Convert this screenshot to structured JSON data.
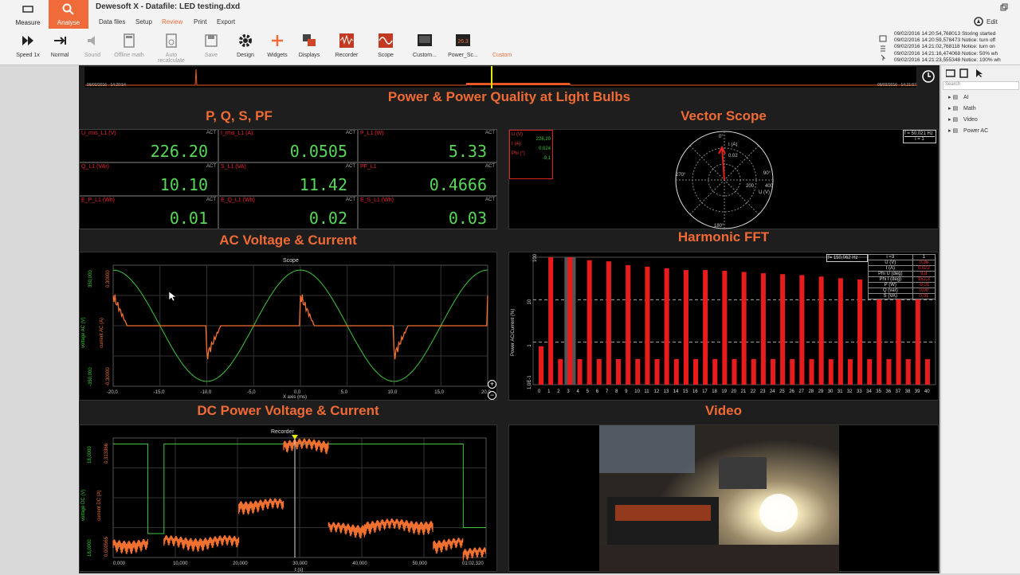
{
  "app": {
    "title": "Dewesoft X - Datafile: LED testing.dxd"
  },
  "tiles": {
    "measure": "Measure",
    "analyse": "Analyse"
  },
  "menu": {
    "datafiles": "Data files",
    "setup": "Setup",
    "review": "Review",
    "print": "Print",
    "export": "Export",
    "edit": "Edit"
  },
  "toolbar": {
    "speed": "Speed 1x",
    "normal": "Normal",
    "sound": "Sound",
    "offline": "Offline math",
    "recalc": "Auto recalculate",
    "save": "Save",
    "design": "Design",
    "widgets": "Widgets",
    "displays": "Displays",
    "recorder": "Recorder",
    "scope": "Scope",
    "custom": "Custom...",
    "power": "Power_Sc...",
    "custom2": "Custom",
    "power_badge": "26.3"
  },
  "log": [
    "09/02/2016 14:20:54,768013 Storing started",
    "09/02/2016 14:20:59,578473 Notice: turn off",
    "09/02/2016 14:21:02,768118 Notice: turn on",
    "09/02/2016 14:21:16,474068 Notice: 50% wh",
    "09/02/2016 14:21:23,555348 Notice: 100% wh"
  ],
  "overview": {
    "start": "09/02/2016 - 14:20:54",
    "end": "09/02/2016 - 14:21:57"
  },
  "headings": {
    "main": "Power & Power Quality at Light Bulbs",
    "pq": "P, Q, S, PF",
    "vector": "Vector Scope",
    "ac": "AC Voltage & Current",
    "fft": "Harmonic FFT",
    "dc": "DC Power Voltage & Current",
    "video": "Video"
  },
  "cells": [
    {
      "label": "U_rms_L1 (V)",
      "value": "226.20"
    },
    {
      "label": "I_rms_L1 (A)",
      "value": "0.0505"
    },
    {
      "label": "P_L1 (W)",
      "value": "5.33"
    },
    {
      "label": "Q_L1 (VAr)",
      "value": "10.10"
    },
    {
      "label": "S_L1 (VA)",
      "value": "11.42"
    },
    {
      "label": "PF_L1",
      "value": "0.4666"
    },
    {
      "label": "E_P_L1 (Wh)",
      "value": "0.01"
    },
    {
      "label": "E_Q_L1 (Wh)",
      "value": "0.02"
    },
    {
      "label": "E_S_L1 (Wh)",
      "value": "0.03"
    }
  ],
  "act": "ACT",
  "vector": {
    "u": "U (V)",
    "u_val": "226,20",
    "i": "I (A)",
    "i_val": "0,024",
    "phi": "Phi (°)",
    "phi_val": "-9,1",
    "freq": "f = 50,021 Hz",
    "idx": "i = 1",
    "d0": "0°",
    "d90": "90°",
    "d180": "180°",
    "d270": "270°",
    "r02": "0.02",
    "r200": "200",
    "r400": "400",
    "uaxis": "U (V)",
    "iaxis": "I (A)"
  },
  "scope": {
    "title": "Scope",
    "xlabel": "X axis (ms)",
    "yl1": "voltage AC (V)",
    "yl2": "current AC (A)",
    "xticks": [
      "-20,0",
      "-15,0",
      "-10,0",
      "-5,0",
      "0,0",
      "5,0",
      "10,0",
      "15,0",
      "20,0"
    ],
    "yv": [
      "350,000",
      "-350,000"
    ],
    "yi": [
      "0,30000",
      "-0,30000"
    ]
  },
  "fft": {
    "freq": "f= 150,062 Hz",
    "ylabel": "Power AC/Current (%)",
    "yticks": [
      "100",
      "10",
      "1",
      "1,0E-1"
    ],
    "xticks": [
      "0",
      "1",
      "2",
      "3",
      "4",
      "5",
      "6",
      "7",
      "8",
      "9",
      "10",
      "11",
      "12",
      "13",
      "14",
      "15",
      "16",
      "17",
      "18",
      "19",
      "20",
      "21",
      "22",
      "23",
      "24",
      "25",
      "26",
      "27",
      "28",
      "29",
      "30",
      "31",
      "32",
      "33",
      "34",
      "35",
      "36",
      "37",
      "38",
      "39",
      "40"
    ],
    "table_head": [
      "i =3",
      "1"
    ],
    "table": [
      [
        "U (V)",
        "0,36"
      ],
      [
        "I (A)",
        "0,022"
      ],
      [
        "Phi U (deg)",
        "9,8"
      ],
      [
        "Phi I (deg)",
        "152,3"
      ],
      [
        "P (W)",
        "-0,01"
      ],
      [
        "Q (var)",
        "0,00"
      ],
      [
        "S (VA)",
        "0,01"
      ]
    ]
  },
  "recorder": {
    "title": "Recorder",
    "xlabel": "t (s)",
    "yl1": "voltage DC (V)",
    "yl2": "current DC (A)",
    "xticks": [
      "0,000",
      "10,000",
      "20,000",
      "30,000",
      "40,000",
      "50,000",
      "01:02,320"
    ],
    "yv": [
      "18,0000",
      "18,0000"
    ],
    "yi": [
      "0,313366",
      "0,000565"
    ]
  },
  "sidebar": {
    "search": "Search",
    "items": [
      "AI",
      "Math",
      "Video",
      "Power AC"
    ]
  },
  "colors": {
    "accent": "#ef6c3a",
    "voltage": "#3cc83c",
    "current": "#f07030",
    "bars": "#e81c1c"
  },
  "chart_data": {
    "type": "bar",
    "categories": [
      "0",
      "1",
      "2",
      "3",
      "4",
      "5",
      "6",
      "7",
      "8",
      "9",
      "10",
      "11",
      "12",
      "13",
      "14",
      "15",
      "16",
      "17",
      "18",
      "19",
      "20",
      "21",
      "22",
      "23",
      "24",
      "25",
      "26",
      "27",
      "28",
      "29",
      "30",
      "31",
      "32",
      "33",
      "34",
      "35",
      "36",
      "37",
      "38",
      "39",
      "40"
    ],
    "values": [
      0.8,
      100,
      0.4,
      100,
      0.4,
      85,
      0.4,
      80,
      0.4,
      65,
      0.4,
      60,
      0.4,
      55,
      0.4,
      50,
      0.4,
      50,
      0.4,
      48,
      0.4,
      45,
      0.4,
      42,
      0.4,
      40,
      0.4,
      38,
      0.4,
      35,
      0.4,
      32,
      0.4,
      30,
      0.4,
      28,
      0.4,
      26,
      0.4,
      24,
      0.4
    ],
    "ylabel": "Power AC/Current (%)",
    "yscale": "log",
    "ylim": [
      0.1,
      100
    ]
  }
}
